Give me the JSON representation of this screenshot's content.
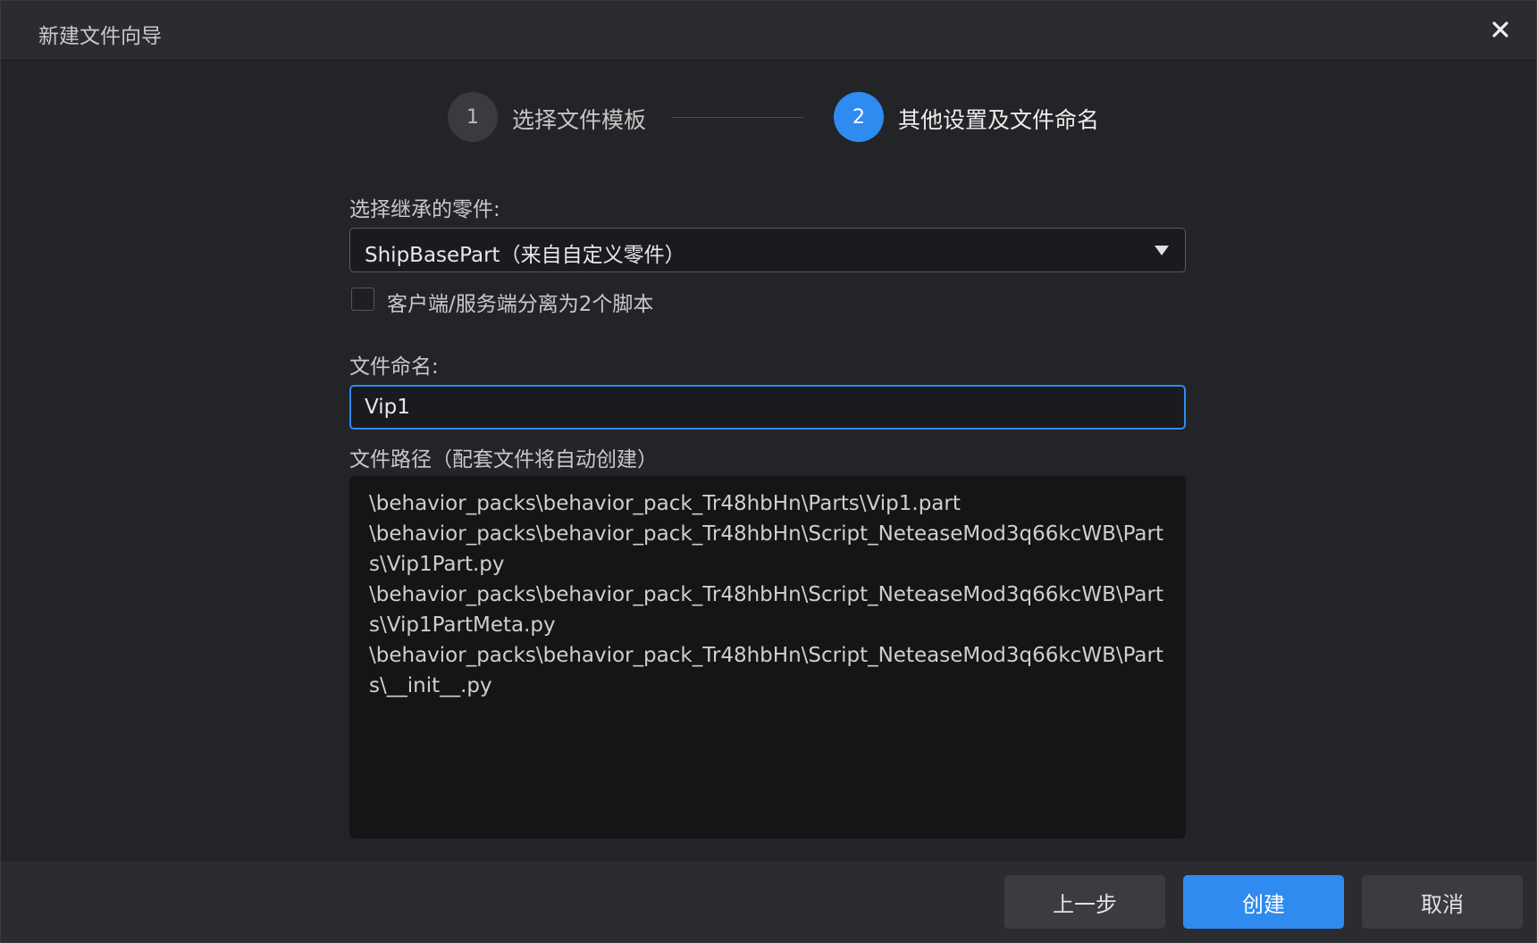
{
  "window": {
    "title": "新建文件向导"
  },
  "steps": [
    {
      "number": "1",
      "label": "选择文件模板"
    },
    {
      "number": "2",
      "label": "其他设置及文件命名"
    }
  ],
  "form": {
    "inherit_label": "选择继承的零件:",
    "inherit_value": "ShipBasePart（来自自定义零件）",
    "split_checkbox_label": "客户端/服务端分离为2个脚本",
    "split_checked": false,
    "name_label": "文件命名:",
    "name_value": "Vip1",
    "path_label": "文件路径（配套文件将自动创建）",
    "paths": [
      "\\behavior_packs\\behavior_pack_Tr48hbHn\\Parts\\Vip1.part",
      "\\behavior_packs\\behavior_pack_Tr48hbHn\\Script_NeteaseMod3q66kcWB\\Parts\\Vip1Part.py",
      "\\behavior_packs\\behavior_pack_Tr48hbHn\\Script_NeteaseMod3q66kcWB\\Parts\\Vip1PartMeta.py",
      "\\behavior_packs\\behavior_pack_Tr48hbHn\\Script_NeteaseMod3q66kcWB\\Parts\\__init__.py"
    ]
  },
  "footer": {
    "prev_label": "上一步",
    "create_label": "创建",
    "cancel_label": "取消"
  },
  "colors": {
    "accent": "#2f8bf0",
    "background": "#232427",
    "titlebar": "#2b2c30"
  },
  "icons": {
    "close": "close-icon",
    "dropdown": "chevron-down-icon"
  }
}
